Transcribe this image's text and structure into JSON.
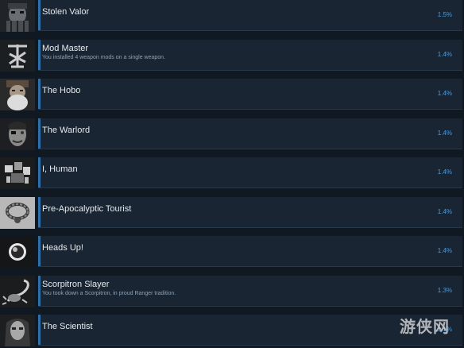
{
  "achievements": [
    {
      "title": "Stolen Valor",
      "description": "",
      "percent": "1.5%",
      "icon": "helmet-portrait-icon"
    },
    {
      "title": "Mod Master",
      "description": "You installed 4 weapon mods on a single weapon.",
      "percent": "1.4%",
      "icon": "weapon-glyph-icon"
    },
    {
      "title": "The Hobo",
      "description": "",
      "percent": "1.4%",
      "icon": "bearded-man-icon"
    },
    {
      "title": "The Warlord",
      "description": "",
      "percent": "1.4%",
      "icon": "warlord-face-icon"
    },
    {
      "title": "I, Human",
      "description": "",
      "percent": "1.4%",
      "icon": "robot-parts-icon"
    },
    {
      "title": "Pre-Apocalyptic Tourist",
      "description": "",
      "percent": "1.4%",
      "icon": "necklace-icon"
    },
    {
      "title": "Heads Up!",
      "description": "",
      "percent": "1.4%",
      "icon": "orb-icon"
    },
    {
      "title": "Scorpitron Slayer",
      "description": "You took down a Scorpitron, in proud Ranger tradition.",
      "percent": "1.3%",
      "icon": "scorpion-icon"
    },
    {
      "title": "The Scientist",
      "description": "",
      "percent": "1.1%",
      "icon": "scientist-face-icon"
    }
  ],
  "watermark": {
    "text": "游侠网"
  },
  "colors": {
    "background": "#101822",
    "row": "#1a2533",
    "accent": "#2f6faa",
    "percent": "#4f9ad8"
  }
}
